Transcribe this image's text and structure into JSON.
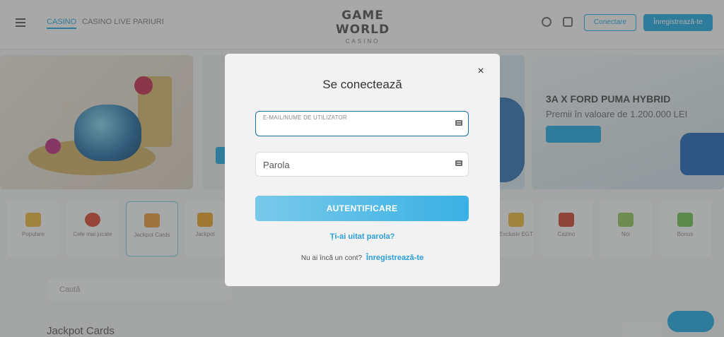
{
  "background": {
    "nav_tabs": [
      {
        "label": "CASINO"
      },
      {
        "label": "CASINO LIVE"
      },
      {
        "label": "PARIURI"
      }
    ],
    "logo": {
      "main": "GAME WORLD",
      "sub": "CASINO"
    },
    "login_label": "Conectare",
    "register_label": "Înregistrează-te",
    "banner_promo": {
      "title": "3A X FORD PUMA HYBRID",
      "subtitle": "Premii în valoare de 1.200.000 LEI"
    },
    "categories": [
      {
        "label": "Populare",
        "color": "#e9b43a"
      },
      {
        "label": "Cele mai jucate",
        "color": "#d8452f"
      },
      {
        "label": "Jackpot Cards",
        "color": "#e39a3a"
      },
      {
        "label": "Jackpot",
        "color": "#e8a124"
      },
      {
        "label": "Exclusiv EGT",
        "color": "#e9b43a"
      },
      {
        "label": "Cazino",
        "color": "#c8432d"
      },
      {
        "label": "Noi",
        "color": "#8ec35c"
      },
      {
        "label": "Bonus",
        "color": "#6cbf4f"
      }
    ],
    "search_placeholder": "Caută",
    "section_title": "Jackpot Cards"
  },
  "modal": {
    "title": "Se conectează",
    "username": {
      "label": "E-MAIL/NUME DE UTILIZATOR",
      "value": ""
    },
    "password": {
      "placeholder": "Parola",
      "value": ""
    },
    "submit_label": "AUTENTIFICARE",
    "forgot_label": "Ți-ai uitat parola?",
    "no_account_text": "Nu ai încă un cont?",
    "signup_label": "Înregistrează-te",
    "close_symbol": "×"
  },
  "colors": {
    "accent": "#2a9fd8",
    "button_gradient_start": "#79c9ea",
    "button_gradient_end": "#3ab0e4",
    "active_field_border": "#1a6fa3"
  },
  "icons": {
    "close": "close-icon",
    "field_autofill": "keyboard-icon",
    "menu": "hamburger-icon"
  }
}
